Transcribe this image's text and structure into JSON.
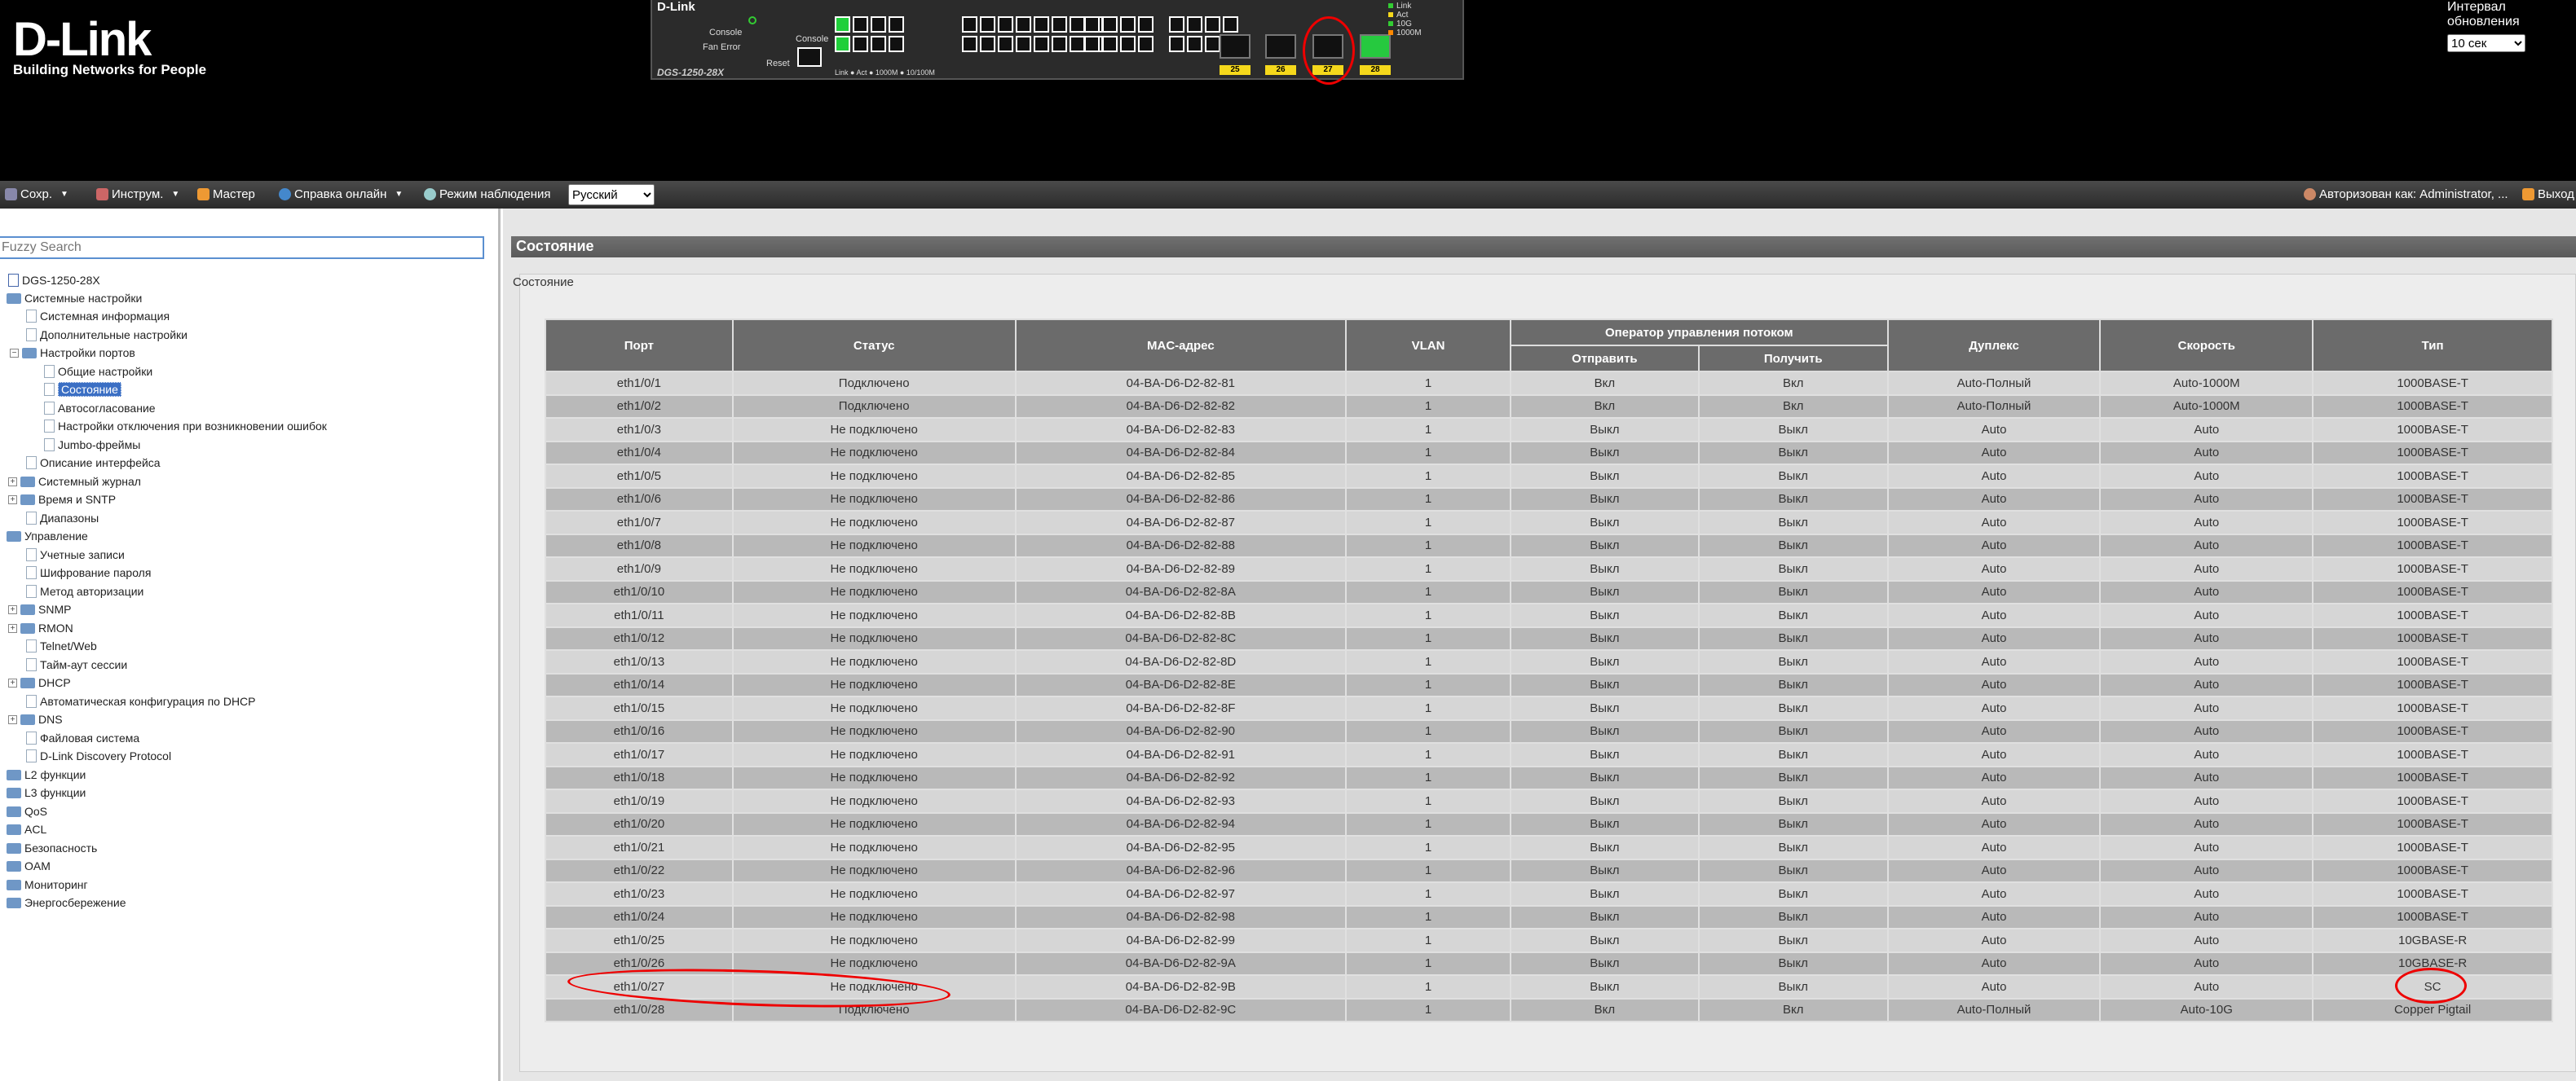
{
  "header": {
    "brand": "D-Link",
    "tagline": "Building Networks for People",
    "panel": {
      "brand": "D-Link",
      "model": "DGS-1250-28X",
      "console_label": "Console",
      "fan_error_label": "Fan Error",
      "console_port_label": "Console",
      "reset_label": "Reset",
      "link_legend": "Link ● Act ● 1000M ● 10/100M",
      "sfp_ports": [
        "25",
        "26",
        "27",
        "28"
      ],
      "legend": [
        "Link",
        "Act",
        "10G",
        "1000M"
      ]
    },
    "refresh": {
      "label": "Интервал обновления",
      "value": "10 сек"
    }
  },
  "toolbar": {
    "save": "Сохр.",
    "tools": "Инструм.",
    "wizard": "Мастер",
    "help": "Справка онлайн",
    "monitor": "Режим наблюдения",
    "language": "Русский",
    "logged_in": "Авторизован как: Administrator, ...",
    "logout": "Выход"
  },
  "sidebar": {
    "search_placeholder": "Fuzzy Search",
    "items": [
      {
        "label": "DGS-1250-28X"
      },
      {
        "label": "Системные настройки"
      },
      {
        "label": "Системная информация"
      },
      {
        "label": "Дополнительные настройки"
      },
      {
        "label": "Настройки портов"
      },
      {
        "label": "Общие настройки"
      },
      {
        "label": "Состояние"
      },
      {
        "label": "Автосогласование"
      },
      {
        "label": "Настройки отключения при возникновении ошибок"
      },
      {
        "label": "Jumbo-фреймы"
      },
      {
        "label": "Описание интерфейса"
      },
      {
        "label": "Системный журнал"
      },
      {
        "label": "Время и SNTP"
      },
      {
        "label": "Диапазоны"
      },
      {
        "label": "Управление"
      },
      {
        "label": "Учетные записи"
      },
      {
        "label": "Шифрование пароля"
      },
      {
        "label": "Метод авторизации"
      },
      {
        "label": "SNMP"
      },
      {
        "label": "RMON"
      },
      {
        "label": "Telnet/Web"
      },
      {
        "label": "Тайм-аут сессии"
      },
      {
        "label": "DHCP"
      },
      {
        "label": "Автоматическая конфигурация по DHCP"
      },
      {
        "label": "DNS"
      },
      {
        "label": "Файловая система"
      },
      {
        "label": "D-Link Discovery Protocol"
      },
      {
        "label": "L2 функции"
      },
      {
        "label": "L3 функции"
      },
      {
        "label": "QoS"
      },
      {
        "label": "ACL"
      },
      {
        "label": "Безопасность"
      },
      {
        "label": "OAM"
      },
      {
        "label": "Мониторинг"
      },
      {
        "label": "Энергосбережение"
      }
    ]
  },
  "main": {
    "header": "Состояние",
    "box_title": "Состояние",
    "columns": {
      "port": "Порт",
      "status": "Статус",
      "mac": "MAC-адрес",
      "vlan": "VLAN",
      "flow": "Оператор управления потоком",
      "send": "Отправить",
      "receive": "Получить",
      "duplex": "Дуплекс",
      "speed": "Скорость",
      "type": "Тип"
    },
    "rows": [
      [
        "eth1/0/1",
        "Подключено",
        "04-BA-D6-D2-82-81",
        "1",
        "Вкл",
        "Вкл",
        "Auto-Полный",
        "Auto-1000M",
        "1000BASE-T"
      ],
      [
        "eth1/0/2",
        "Подключено",
        "04-BA-D6-D2-82-82",
        "1",
        "Вкл",
        "Вкл",
        "Auto-Полный",
        "Auto-1000M",
        "1000BASE-T"
      ],
      [
        "eth1/0/3",
        "Не подключено",
        "04-BA-D6-D2-82-83",
        "1",
        "Выкл",
        "Выкл",
        "Auto",
        "Auto",
        "1000BASE-T"
      ],
      [
        "eth1/0/4",
        "Не подключено",
        "04-BA-D6-D2-82-84",
        "1",
        "Выкл",
        "Выкл",
        "Auto",
        "Auto",
        "1000BASE-T"
      ],
      [
        "eth1/0/5",
        "Не подключено",
        "04-BA-D6-D2-82-85",
        "1",
        "Выкл",
        "Выкл",
        "Auto",
        "Auto",
        "1000BASE-T"
      ],
      [
        "eth1/0/6",
        "Не подключено",
        "04-BA-D6-D2-82-86",
        "1",
        "Выкл",
        "Выкл",
        "Auto",
        "Auto",
        "1000BASE-T"
      ],
      [
        "eth1/0/7",
        "Не подключено",
        "04-BA-D6-D2-82-87",
        "1",
        "Выкл",
        "Выкл",
        "Auto",
        "Auto",
        "1000BASE-T"
      ],
      [
        "eth1/0/8",
        "Не подключено",
        "04-BA-D6-D2-82-88",
        "1",
        "Выкл",
        "Выкл",
        "Auto",
        "Auto",
        "1000BASE-T"
      ],
      [
        "eth1/0/9",
        "Не подключено",
        "04-BA-D6-D2-82-89",
        "1",
        "Выкл",
        "Выкл",
        "Auto",
        "Auto",
        "1000BASE-T"
      ],
      [
        "eth1/0/10",
        "Не подключено",
        "04-BA-D6-D2-82-8A",
        "1",
        "Выкл",
        "Выкл",
        "Auto",
        "Auto",
        "1000BASE-T"
      ],
      [
        "eth1/0/11",
        "Не подключено",
        "04-BA-D6-D2-82-8B",
        "1",
        "Выкл",
        "Выкл",
        "Auto",
        "Auto",
        "1000BASE-T"
      ],
      [
        "eth1/0/12",
        "Не подключено",
        "04-BA-D6-D2-82-8C",
        "1",
        "Выкл",
        "Выкл",
        "Auto",
        "Auto",
        "1000BASE-T"
      ],
      [
        "eth1/0/13",
        "Не подключено",
        "04-BA-D6-D2-82-8D",
        "1",
        "Выкл",
        "Выкл",
        "Auto",
        "Auto",
        "1000BASE-T"
      ],
      [
        "eth1/0/14",
        "Не подключено",
        "04-BA-D6-D2-82-8E",
        "1",
        "Выкл",
        "Выкл",
        "Auto",
        "Auto",
        "1000BASE-T"
      ],
      [
        "eth1/0/15",
        "Не подключено",
        "04-BA-D6-D2-82-8F",
        "1",
        "Выкл",
        "Выкл",
        "Auto",
        "Auto",
        "1000BASE-T"
      ],
      [
        "eth1/0/16",
        "Не подключено",
        "04-BA-D6-D2-82-90",
        "1",
        "Выкл",
        "Выкл",
        "Auto",
        "Auto",
        "1000BASE-T"
      ],
      [
        "eth1/0/17",
        "Не подключено",
        "04-BA-D6-D2-82-91",
        "1",
        "Выкл",
        "Выкл",
        "Auto",
        "Auto",
        "1000BASE-T"
      ],
      [
        "eth1/0/18",
        "Не подключено",
        "04-BA-D6-D2-82-92",
        "1",
        "Выкл",
        "Выкл",
        "Auto",
        "Auto",
        "1000BASE-T"
      ],
      [
        "eth1/0/19",
        "Не подключено",
        "04-BA-D6-D2-82-93",
        "1",
        "Выкл",
        "Выкл",
        "Auto",
        "Auto",
        "1000BASE-T"
      ],
      [
        "eth1/0/20",
        "Не подключено",
        "04-BA-D6-D2-82-94",
        "1",
        "Выкл",
        "Выкл",
        "Auto",
        "Auto",
        "1000BASE-T"
      ],
      [
        "eth1/0/21",
        "Не подключено",
        "04-BA-D6-D2-82-95",
        "1",
        "Выкл",
        "Выкл",
        "Auto",
        "Auto",
        "1000BASE-T"
      ],
      [
        "eth1/0/22",
        "Не подключено",
        "04-BA-D6-D2-82-96",
        "1",
        "Выкл",
        "Выкл",
        "Auto",
        "Auto",
        "1000BASE-T"
      ],
      [
        "eth1/0/23",
        "Не подключено",
        "04-BA-D6-D2-82-97",
        "1",
        "Выкл",
        "Выкл",
        "Auto",
        "Auto",
        "1000BASE-T"
      ],
      [
        "eth1/0/24",
        "Не подключено",
        "04-BA-D6-D2-82-98",
        "1",
        "Выкл",
        "Выкл",
        "Auto",
        "Auto",
        "1000BASE-T"
      ],
      [
        "eth1/0/25",
        "Не подключено",
        "04-BA-D6-D2-82-99",
        "1",
        "Выкл",
        "Выкл",
        "Auto",
        "Auto",
        "10GBASE-R"
      ],
      [
        "eth1/0/26",
        "Не подключено",
        "04-BA-D6-D2-82-9A",
        "1",
        "Выкл",
        "Выкл",
        "Auto",
        "Auto",
        "10GBASE-R"
      ],
      [
        "eth1/0/27",
        "Не подключено",
        "04-BA-D6-D2-82-9B",
        "1",
        "Выкл",
        "Выкл",
        "Auto",
        "Auto",
        "SC"
      ],
      [
        "eth1/0/28",
        "Подключено",
        "04-BA-D6-D2-82-9C",
        "1",
        "Вкл",
        "Вкл",
        "Auto-Полный",
        "Auto-10G",
        "Copper Pigtail"
      ]
    ]
  },
  "colors": {
    "header_bg": "#000000",
    "port_up": "#1fcf3a",
    "table_header": "#6b6b6b",
    "annotation": "#e00000",
    "selected_tree": "#3b6fc4"
  }
}
